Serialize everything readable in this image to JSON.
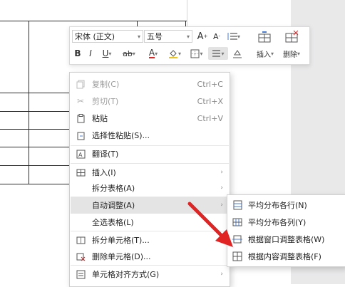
{
  "colors": {
    "arrow": "#e02424",
    "menu_highlight": "#e4e4e4",
    "icon_blue": "#4a7bd3"
  },
  "toolbar": {
    "font_name": "宋体 (正文)",
    "font_size": "五号",
    "grow_font_icon": "grow-font-icon",
    "shrink_font_icon": "shrink-font-icon",
    "insert_label": "插入",
    "delete_label": "删除",
    "bold": "B",
    "italic": "I",
    "underline": "U",
    "font_color": "A"
  },
  "context_menu": {
    "items": [
      {
        "label": "复制(C)",
        "shortcut": "Ctrl+C",
        "icon": "copy-icon",
        "disabled": true
      },
      {
        "label": "剪切(T)",
        "shortcut": "Ctrl+X",
        "icon": "cut-icon",
        "disabled": true
      },
      {
        "label": "粘贴",
        "shortcut": "Ctrl+V",
        "icon": "paste-icon"
      },
      {
        "label": "选择性粘贴(S)...",
        "icon": "paste-special-icon"
      },
      {
        "label": "翻译(T)",
        "icon": "translate-icon"
      },
      {
        "label": "插入(I)",
        "icon": "table-insert-icon",
        "submenu": true
      },
      {
        "label": "拆分表格(A)",
        "submenu": true
      },
      {
        "label": "自动调整(A)",
        "submenu": true,
        "highlighted": true
      },
      {
        "label": "全选表格(L)"
      },
      {
        "label": "拆分单元格(T)...",
        "icon": "split-cells-icon"
      },
      {
        "label": "删除单元格(D)...",
        "icon": "delete-cells-icon"
      },
      {
        "label": "单元格对齐方式(G)",
        "icon": "cell-align-icon",
        "submenu": true
      }
    ]
  },
  "submenu": {
    "items": [
      {
        "label": "平均分布各行(N)",
        "icon": "distribute-rows-icon"
      },
      {
        "label": "平均分布各列(Y)",
        "icon": "distribute-columns-icon"
      },
      {
        "label": "根据窗口调整表格(W)",
        "icon": "autofit-window-icon"
      },
      {
        "label": "根据内容调整表格(F)",
        "icon": "autofit-contents-icon"
      }
    ]
  }
}
